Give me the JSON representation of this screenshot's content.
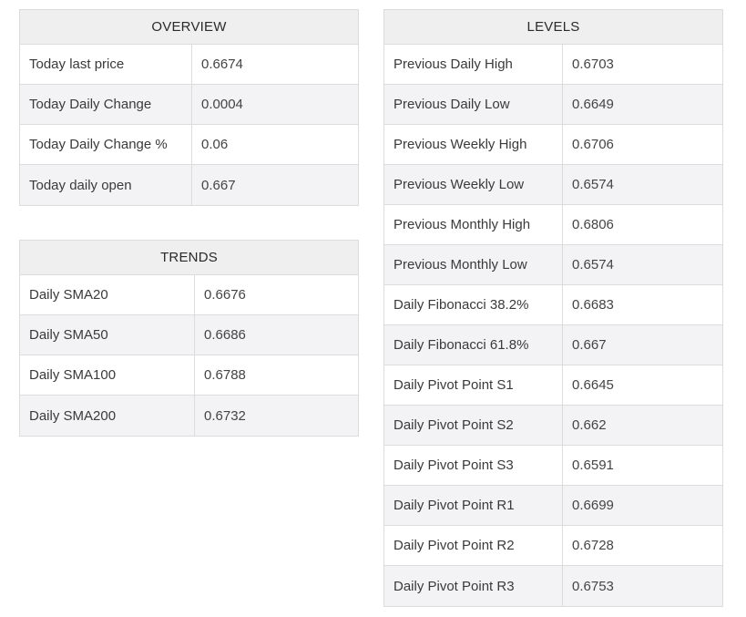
{
  "overview": {
    "title": "OVERVIEW",
    "rows": [
      {
        "label": "Today last price",
        "value": "0.6674"
      },
      {
        "label": "Today Daily Change",
        "value": "0.0004"
      },
      {
        "label": "Today Daily Change %",
        "value": "0.06"
      },
      {
        "label": "Today daily open",
        "value": "0.667"
      }
    ]
  },
  "trends": {
    "title": "TRENDS",
    "rows": [
      {
        "label": "Daily SMA20",
        "value": "0.6676"
      },
      {
        "label": "Daily SMA50",
        "value": "0.6686"
      },
      {
        "label": "Daily SMA100",
        "value": "0.6788"
      },
      {
        "label": "Daily SMA200",
        "value": "0.6732"
      }
    ]
  },
  "levels": {
    "title": "LEVELS",
    "rows": [
      {
        "label": "Previous Daily High",
        "value": "0.6703"
      },
      {
        "label": "Previous Daily Low",
        "value": "0.6649"
      },
      {
        "label": "Previous Weekly High",
        "value": "0.6706"
      },
      {
        "label": "Previous Weekly Low",
        "value": "0.6574"
      },
      {
        "label": "Previous Monthly High",
        "value": "0.6806"
      },
      {
        "label": "Previous Monthly Low",
        "value": "0.6574"
      },
      {
        "label": "Daily Fibonacci 38.2%",
        "value": "0.6683"
      },
      {
        "label": "Daily Fibonacci 61.8%",
        "value": "0.667"
      },
      {
        "label": "Daily Pivot Point S1",
        "value": "0.6645"
      },
      {
        "label": "Daily Pivot Point S2",
        "value": "0.662"
      },
      {
        "label": "Daily Pivot Point S3",
        "value": "0.6591"
      },
      {
        "label": "Daily Pivot Point R1",
        "value": "0.6699"
      },
      {
        "label": "Daily Pivot Point R2",
        "value": "0.6728"
      },
      {
        "label": "Daily Pivot Point R3",
        "value": "0.6753"
      }
    ]
  },
  "colors": {
    "header_bg": "#efefef",
    "row_shade": "#f3f3f6",
    "border": "#dcdcdc"
  }
}
